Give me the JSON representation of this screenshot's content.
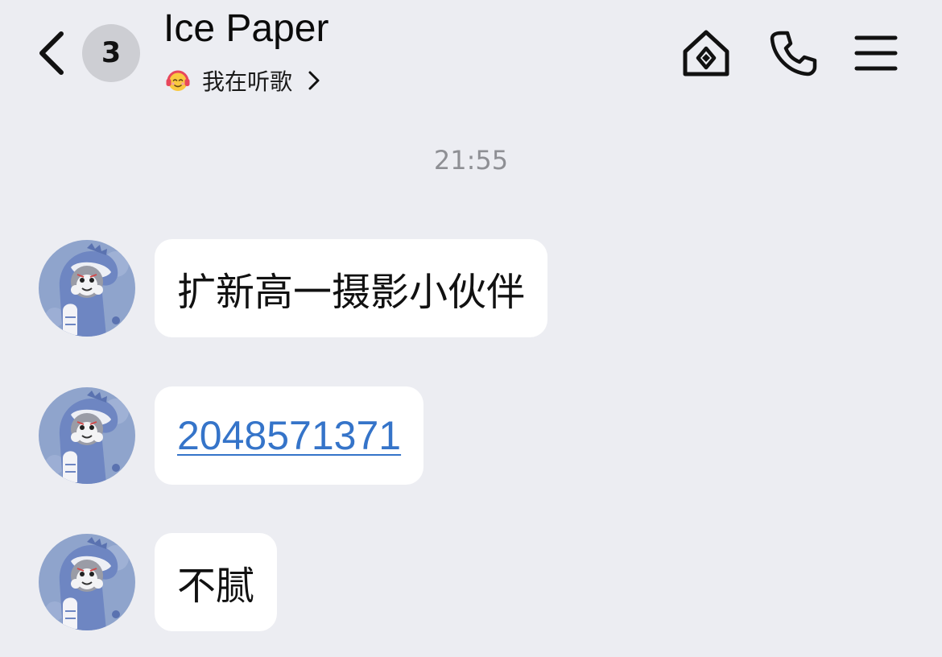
{
  "header": {
    "unread_count": "3",
    "contact_name": "Ice Paper",
    "status_text": "我在听歌",
    "icons": {
      "back": "chevron-left-icon",
      "status": "headphones-emoji-icon",
      "status_more": "chevron-right-icon",
      "home": "home-icon",
      "call": "phone-icon",
      "menu": "hamburger-menu-icon"
    }
  },
  "conversation": {
    "timestamp": "21:55",
    "messages": [
      {
        "sender": "Ice Paper",
        "text": "扩新高一摄影小伙伴"
      },
      {
        "sender": "Ice Paper",
        "text": "2048571371",
        "is_link": true
      },
      {
        "sender": "Ice Paper",
        "text": "不腻"
      }
    ]
  },
  "colors": {
    "background": "#ECEDF2",
    "bubble": "#FFFFFF",
    "link": "#3574C9",
    "badge": "#CDCED3",
    "timestamp": "#8E8F94"
  }
}
